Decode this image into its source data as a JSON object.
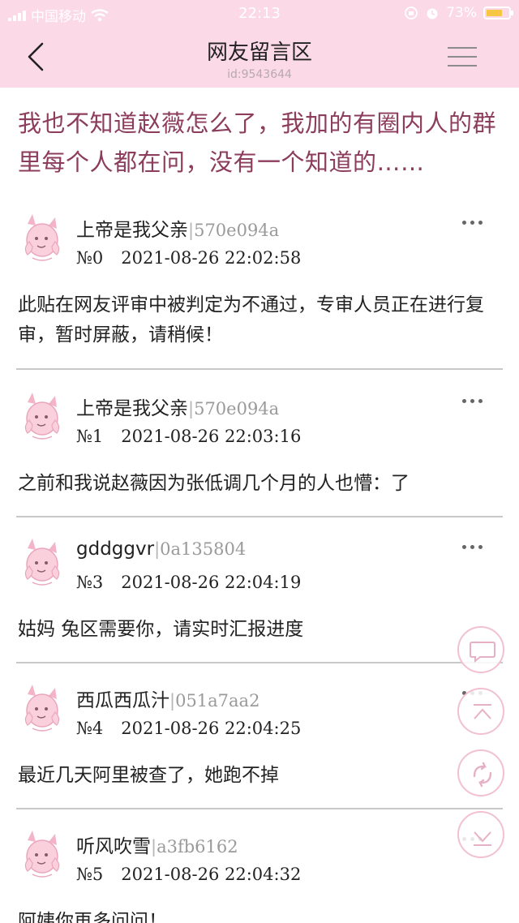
{
  "status_bar": {
    "carrier": "中国移动",
    "time": "22:13",
    "battery": "73%"
  },
  "nav": {
    "title": "网友留言区",
    "subtitle": "id:9543644",
    "back_icon": "chevron-left-icon",
    "menu_icon": "hamburger-menu-icon"
  },
  "headline": "我也不知道赵薇怎么了，我加的有圈内人的群里每个人都在问，没有一个知道的……",
  "posts": [
    {
      "name": "上帝是我父亲",
      "sep": "|",
      "uid": "570e094a",
      "no": "№0",
      "datetime": "2021-08-26 22:02:58",
      "text": "此贴在网友评审中被判定为不通过，专审人员正在进行复审，暂时屏蔽，请稍候！"
    },
    {
      "name": "上帝是我父亲",
      "sep": "|",
      "uid": "570e094a",
      "no": "№1",
      "datetime": "2021-08-26 22:03:16",
      "text": "之前和我说赵薇因为张低调几个月的人也懵：了"
    },
    {
      "name": "gddggvr",
      "sep": "|",
      "uid": "0a135804",
      "no": "№3",
      "datetime": "2021-08-26 22:04:19",
      "text": "姑妈 兔区需要你，请实时汇报进度"
    },
    {
      "name": "西瓜西瓜汁",
      "sep": "|",
      "uid": "051a7aa2",
      "no": "№4",
      "datetime": "2021-08-26 22:04:25",
      "text": "最近几天阿里被查了，她跑不掉"
    },
    {
      "name": "听风吹雪",
      "sep": "|",
      "uid": "a3fb6162",
      "no": "№5",
      "datetime": "2021-08-26 22:04:32",
      "text": "阿姨你再多问问！"
    }
  ],
  "fabs": [
    {
      "icon": "comment-icon"
    },
    {
      "icon": "scroll-to-top-icon"
    },
    {
      "icon": "refresh-icon"
    },
    {
      "icon": "scroll-to-bottom-icon"
    }
  ],
  "colors": {
    "header_bg": "#fbd9e6",
    "headline": "#8c3d5c",
    "fab_border": "#f2c0d2"
  }
}
